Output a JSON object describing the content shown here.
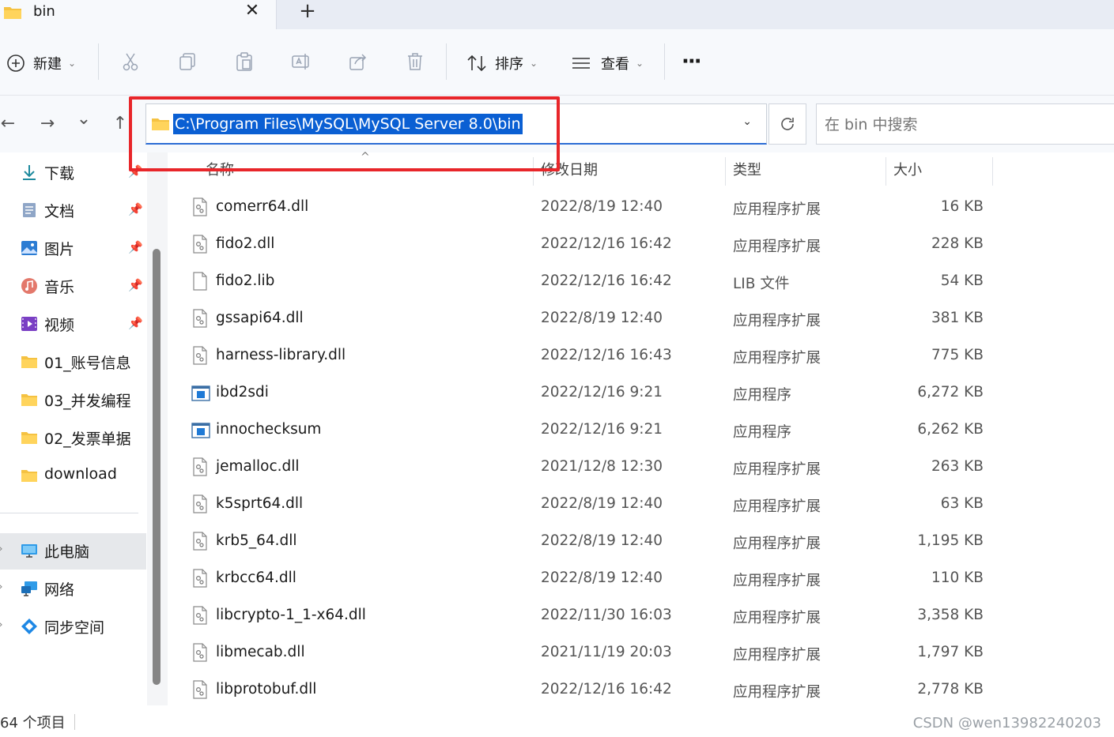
{
  "tab": {
    "title": "bin",
    "close": "✕",
    "new_tab": "+"
  },
  "toolbar": {
    "new_label": "新建",
    "sort_label": "排序",
    "view_label": "查看",
    "more": "···",
    "icons": [
      "cut-icon",
      "copy-icon",
      "paste-icon",
      "rename-icon",
      "share-icon",
      "delete-icon"
    ]
  },
  "nav": {
    "back": "←",
    "forward": "→",
    "recent": "⌄",
    "up": "↑",
    "address": "C:\\Program Files\\MySQL\\MySQL Server 8.0\\bin",
    "search_placeholder": "在 bin 中搜索",
    "highlight_color": "#e8262a"
  },
  "sidebar": {
    "items": [
      {
        "label": "下载",
        "icon": "download-icon",
        "pinned": true
      },
      {
        "label": "文档",
        "icon": "document-icon",
        "pinned": true
      },
      {
        "label": "图片",
        "icon": "pictures-icon",
        "pinned": true
      },
      {
        "label": "音乐",
        "icon": "music-icon",
        "pinned": true
      },
      {
        "label": "视频",
        "icon": "video-icon",
        "pinned": true
      },
      {
        "label": "01_账号信息",
        "icon": "folder-icon",
        "pinned": false
      },
      {
        "label": "03_并发编程",
        "icon": "folder-icon",
        "pinned": false
      },
      {
        "label": "02_发票单据",
        "icon": "folder-icon",
        "pinned": false
      },
      {
        "label": "download",
        "icon": "folder-icon",
        "pinned": false
      }
    ],
    "locations": [
      {
        "label": "此电脑",
        "icon": "this-pc-icon",
        "selected": true
      },
      {
        "label": "网络",
        "icon": "network-icon",
        "selected": false
      },
      {
        "label": "同步空间",
        "icon": "sync-space-icon",
        "selected": false
      }
    ]
  },
  "columns": {
    "name": "名称",
    "date": "修改日期",
    "type": "类型",
    "size": "大小"
  },
  "files": [
    {
      "name": "comerr64.dll",
      "date": "2022/8/19 12:40",
      "type": "应用程序扩展",
      "size": "16 KB",
      "kind": "dll"
    },
    {
      "name": "fido2.dll",
      "date": "2022/12/16 16:42",
      "type": "应用程序扩展",
      "size": "228 KB",
      "kind": "dll"
    },
    {
      "name": "fido2.lib",
      "date": "2022/12/16 16:42",
      "type": "LIB 文件",
      "size": "54 KB",
      "kind": "lib"
    },
    {
      "name": "gssapi64.dll",
      "date": "2022/8/19 12:40",
      "type": "应用程序扩展",
      "size": "381 KB",
      "kind": "dll"
    },
    {
      "name": "harness-library.dll",
      "date": "2022/12/16 16:43",
      "type": "应用程序扩展",
      "size": "775 KB",
      "kind": "dll"
    },
    {
      "name": "ibd2sdi",
      "date": "2022/12/16 9:21",
      "type": "应用程序",
      "size": "6,272 KB",
      "kind": "exe"
    },
    {
      "name": "innochecksum",
      "date": "2022/12/16 9:21",
      "type": "应用程序",
      "size": "6,262 KB",
      "kind": "exe"
    },
    {
      "name": "jemalloc.dll",
      "date": "2021/12/8 12:30",
      "type": "应用程序扩展",
      "size": "263 KB",
      "kind": "dll"
    },
    {
      "name": "k5sprt64.dll",
      "date": "2022/8/19 12:40",
      "type": "应用程序扩展",
      "size": "63 KB",
      "kind": "dll"
    },
    {
      "name": "krb5_64.dll",
      "date": "2022/8/19 12:40",
      "type": "应用程序扩展",
      "size": "1,195 KB",
      "kind": "dll"
    },
    {
      "name": "krbcc64.dll",
      "date": "2022/8/19 12:40",
      "type": "应用程序扩展",
      "size": "110 KB",
      "kind": "dll"
    },
    {
      "name": "libcrypto-1_1-x64.dll",
      "date": "2022/11/30 16:03",
      "type": "应用程序扩展",
      "size": "3,358 KB",
      "kind": "dll"
    },
    {
      "name": "libmecab.dll",
      "date": "2021/11/19 20:03",
      "type": "应用程序扩展",
      "size": "1,797 KB",
      "kind": "dll"
    },
    {
      "name": "libprotobuf.dll",
      "date": "2022/12/16 16:42",
      "type": "应用程序扩展",
      "size": "2,778 KB",
      "kind": "dll"
    }
  ],
  "status": {
    "count": "64 个项目",
    "watermark": "CSDN @wen13982240203"
  }
}
